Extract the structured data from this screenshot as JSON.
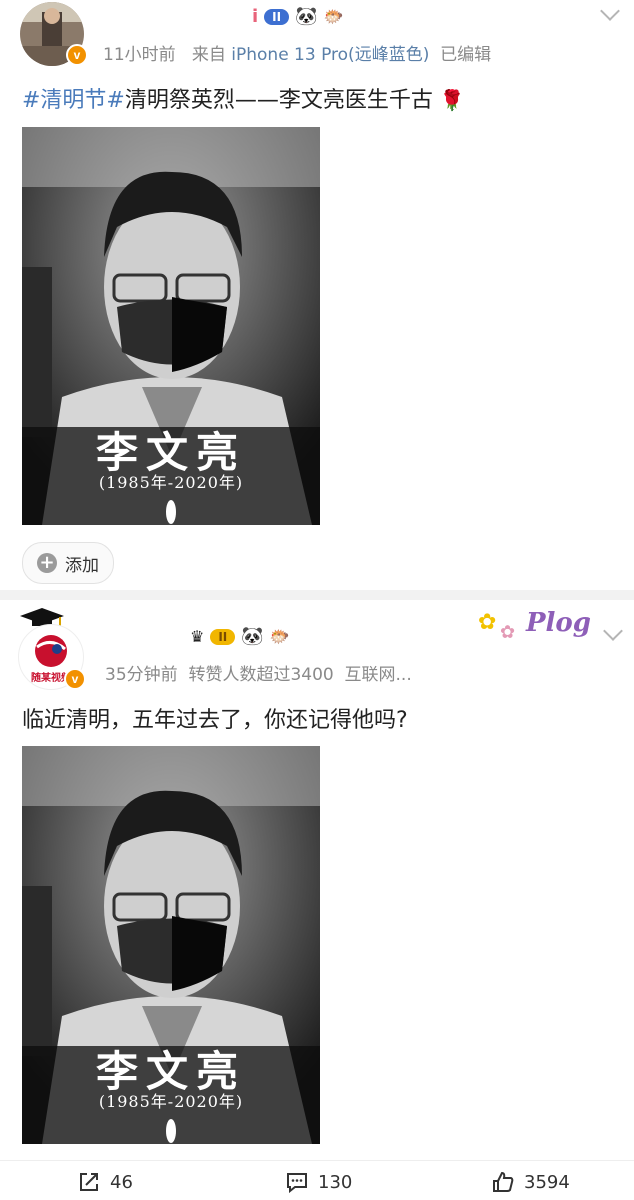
{
  "post1": {
    "meta_time": "11小时前",
    "meta_from": "来自",
    "meta_device": "iPhone 13 Pro(远峰蓝色)",
    "meta_edited": "已编辑",
    "content_tag1": "#清明节#",
    "content_text": "清明祭英烈——李文亮医生千古",
    "image_name": "李文亮",
    "image_years": "(1985年-2020年)",
    "add_label": "添加",
    "badge_level": "II"
  },
  "post2": {
    "avatar_text": "随某视频",
    "meta_time": "35分钟前",
    "meta_repost": "转赞人数超过3400",
    "meta_source": "互联网...",
    "content_text": "临近清明，五年过去了，你还记得他吗?",
    "image_name": "李文亮",
    "image_years": "(1985年-2020年)",
    "badge_level": "II",
    "sticker_text": "Plog"
  },
  "actions": {
    "repost_count": "46",
    "comment_count": "130",
    "like_count": "3594"
  },
  "colors": {
    "accent": "#f29100",
    "link": "#4a7bbb"
  }
}
